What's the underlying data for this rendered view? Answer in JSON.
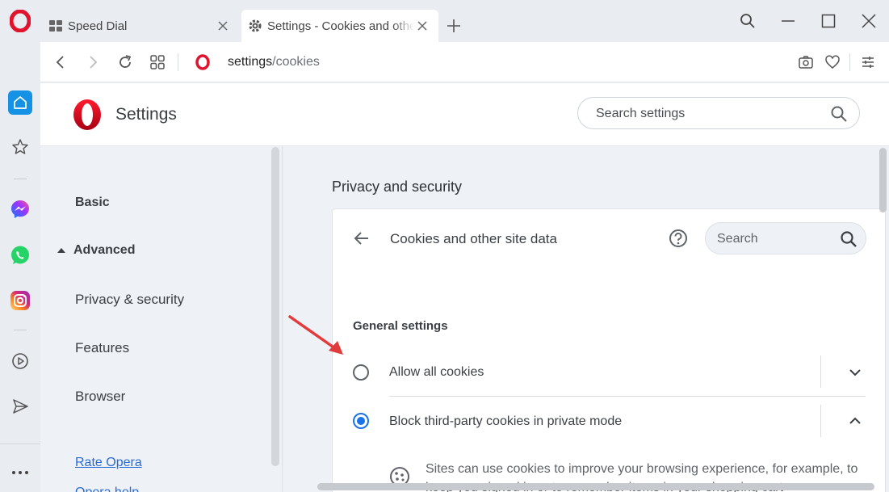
{
  "tabs": {
    "inactive": {
      "title": "Speed Dial",
      "icon": "speed-dial-icon"
    },
    "active": {
      "title": "Settings - Cookies and other site data",
      "icon": "gear-icon"
    }
  },
  "address": {
    "host": "settings",
    "path": "/cookies"
  },
  "header": {
    "title": "Settings",
    "search_placeholder": "Search settings"
  },
  "leftnav": {
    "basic": "Basic",
    "advanced": "Advanced",
    "items": [
      "Privacy & security",
      "Features",
      "Browser"
    ],
    "links": [
      "Rate Opera",
      "Opera help"
    ]
  },
  "main": {
    "section_title": "Privacy and security",
    "card_title": "Cookies and other site data",
    "search_placeholder": "Search",
    "general_settings": "General settings",
    "options": [
      {
        "label": "Allow all cookies",
        "checked": false
      },
      {
        "label": "Block third-party cookies in private mode",
        "checked": true
      }
    ],
    "description": "Sites can use cookies to improve your browsing experience, for example, to keep you signed in or to remember items in your shopping cart"
  },
  "colors": {
    "accent": "#1a73e8",
    "opera_red": "#e0142d",
    "annotation": "#e23b3b"
  }
}
